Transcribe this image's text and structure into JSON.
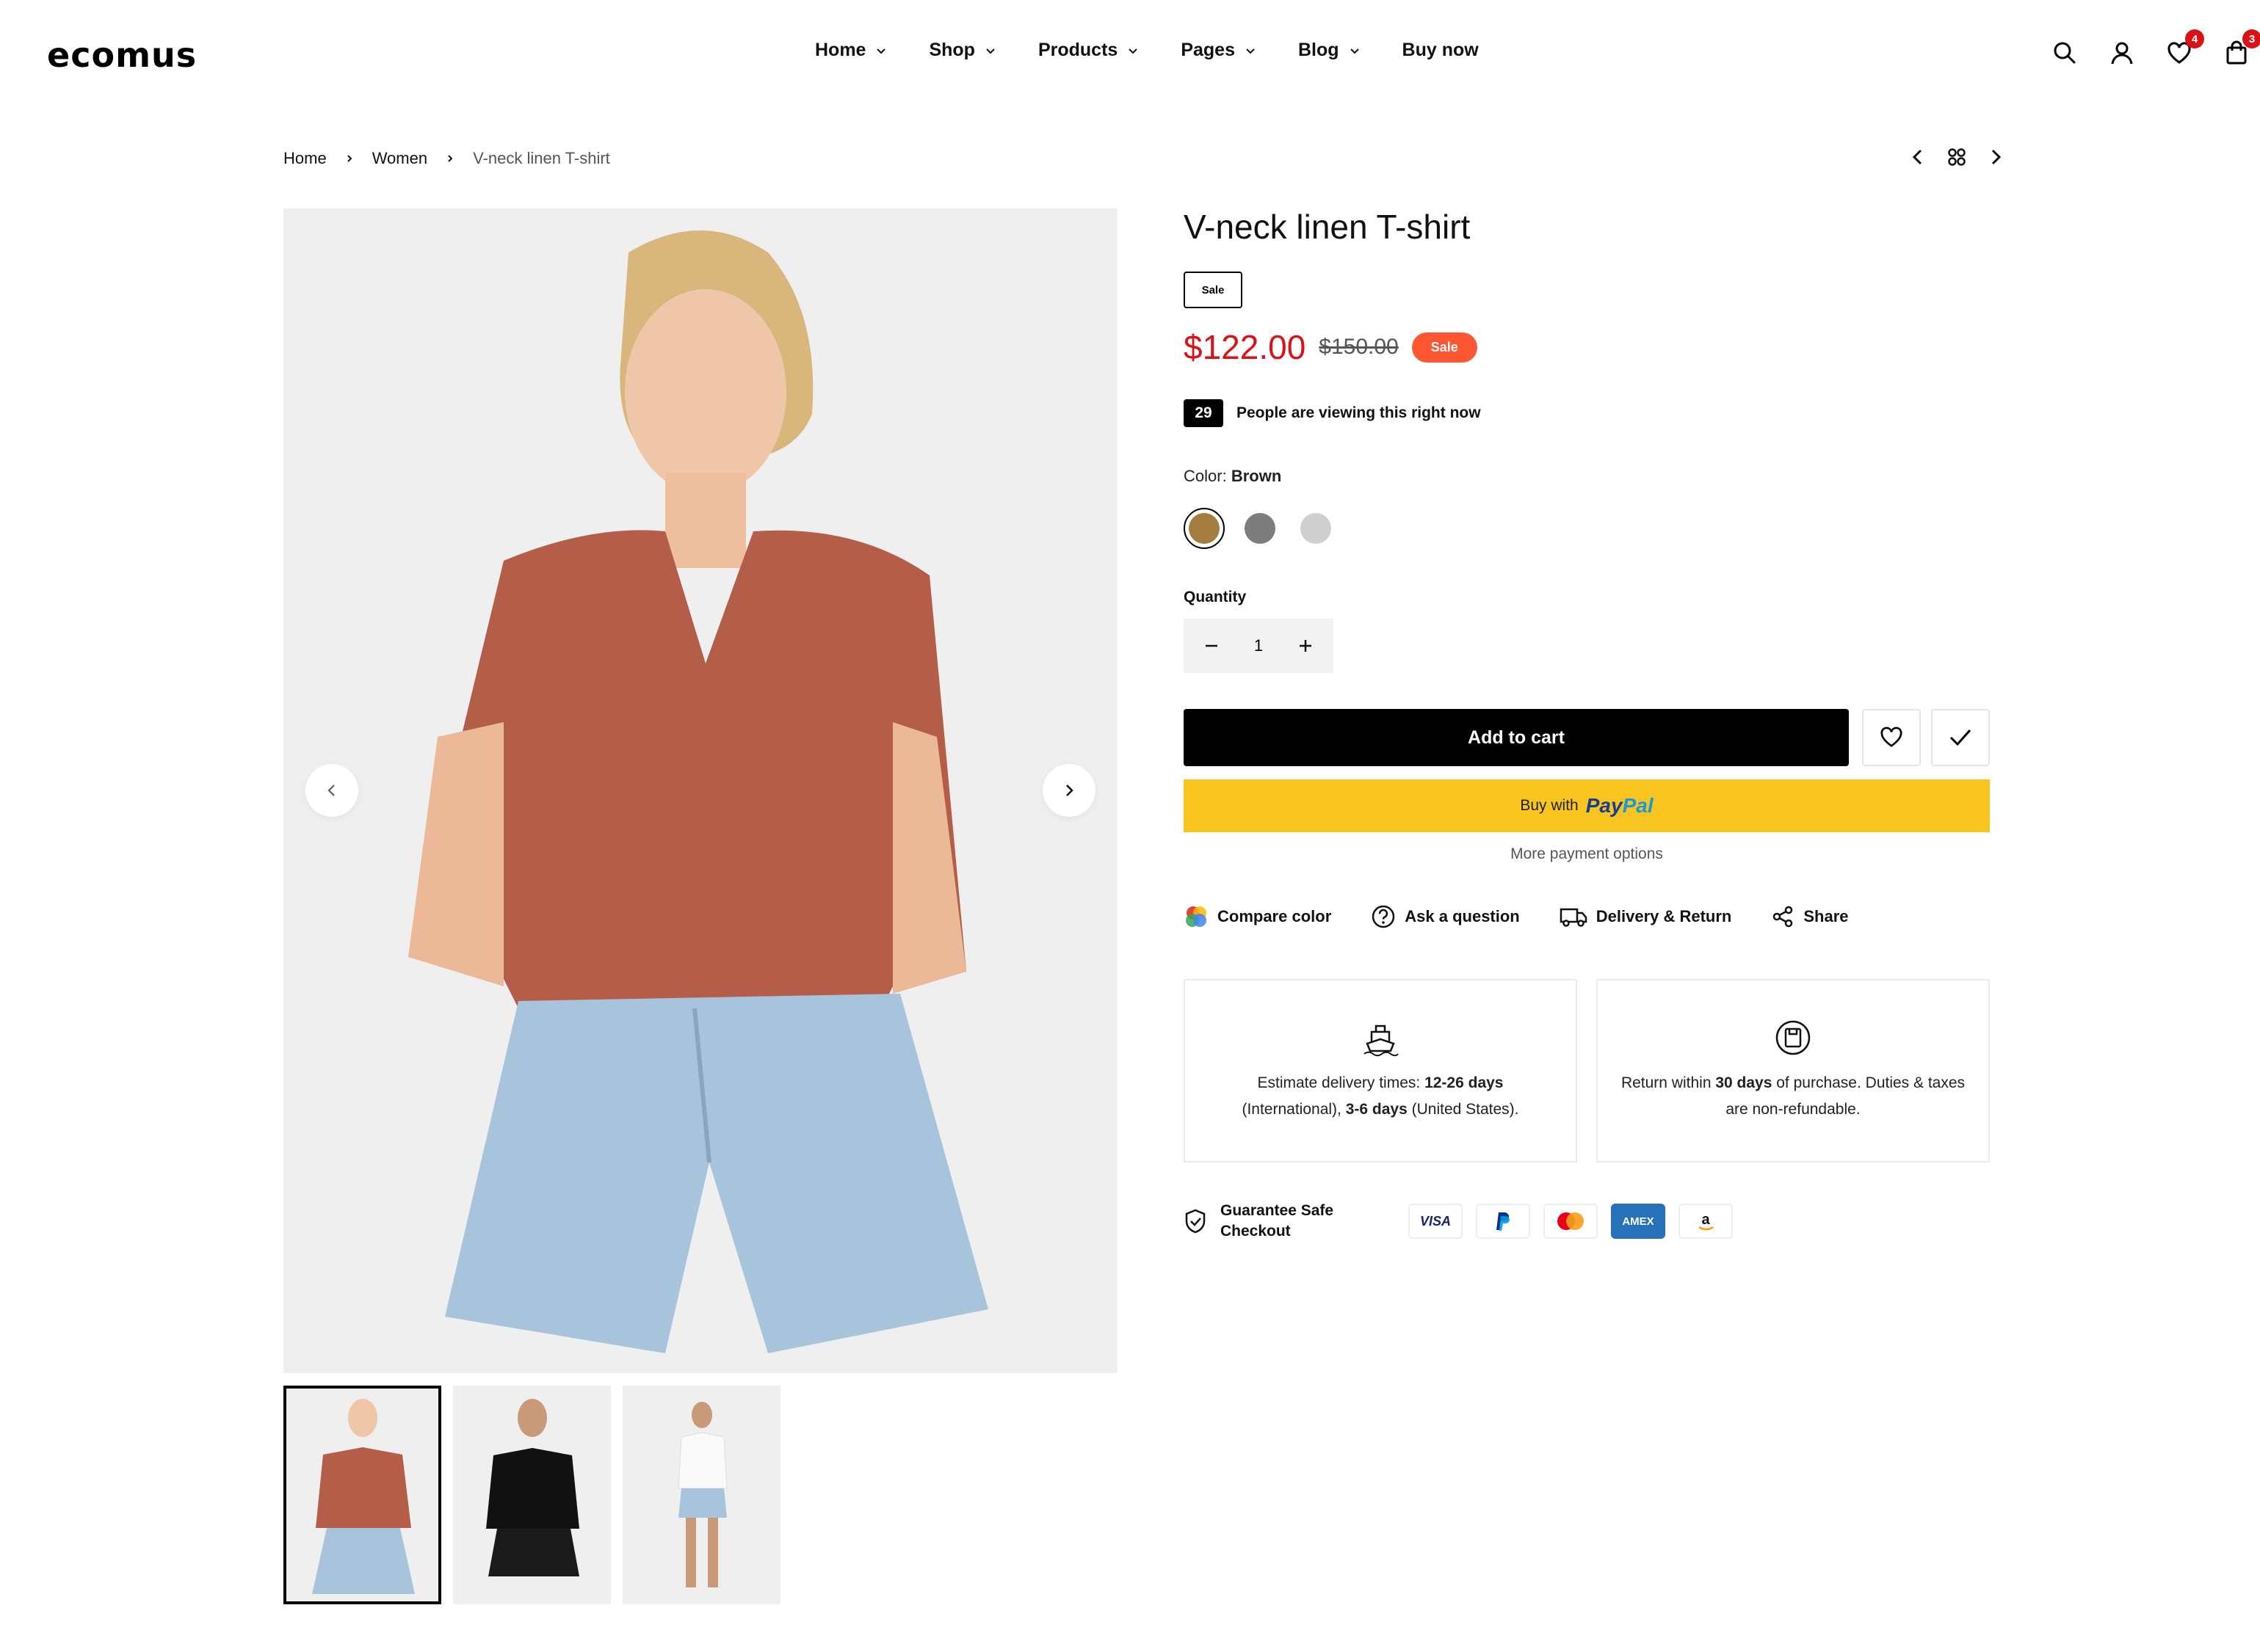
{
  "header": {
    "logo": "ecomus",
    "nav": [
      {
        "label": "Home",
        "has_dropdown": true
      },
      {
        "label": "Shop",
        "has_dropdown": true
      },
      {
        "label": "Products",
        "has_dropdown": true
      },
      {
        "label": "Pages",
        "has_dropdown": true
      },
      {
        "label": "Blog",
        "has_dropdown": true
      },
      {
        "label": "Buy now",
        "has_dropdown": false
      }
    ],
    "icons": [
      "search-icon",
      "user-icon",
      "heart-icon",
      "cart-icon"
    ],
    "wishlist_count": "4",
    "cart_count": "3",
    "badge_color": "#db1215"
  },
  "breadcrumb": {
    "items": [
      "Home",
      "Women",
      "V-neck linen T-shirt"
    ]
  },
  "gallery": {
    "thumb_count": 3,
    "active_thumb": 0
  },
  "product": {
    "title": "V-neck linen T-shirt",
    "tag": "Sale",
    "price": "$122.00",
    "compare_price": "$150.00",
    "sale_badge": "Sale",
    "viewing_count": "29",
    "viewing_text": "People are viewing this right now",
    "color_label": "Color:",
    "color_value": "Brown",
    "swatches": [
      {
        "name": "Brown",
        "hex": "#a57c3f",
        "selected": true
      },
      {
        "name": "Gray",
        "hex": "#7d7d7d",
        "selected": false
      },
      {
        "name": "Light Gray",
        "hex": "#cfcfcf",
        "selected": false
      }
    ],
    "quantity_label": "Quantity",
    "quantity": "1",
    "add_to_cart": "Add to cart",
    "paypal_prefix": "Buy with",
    "paypal_brand_a": "Pay",
    "paypal_brand_b": "Pal",
    "more_payment": "More payment options",
    "extras": [
      {
        "label": "Compare color",
        "icon": "compare-color-icon"
      },
      {
        "label": "Ask a question",
        "icon": "question-icon"
      },
      {
        "label": "Delivery & Return",
        "icon": "truck-icon"
      },
      {
        "label": "Share",
        "icon": "share-icon"
      }
    ],
    "delivery": {
      "t1": "Estimate delivery times: ",
      "b1": "12-26 days",
      "t2": " (International), ",
      "b2": "3-6 days",
      "t3": " (United States)."
    },
    "returns": {
      "t1": "Return within ",
      "b1": "30 days",
      "t2": " of purchase. Duties & taxes are non-refundable."
    },
    "guarantee": "Guarantee Safe Checkout",
    "payment_methods": [
      "VISA",
      "PayPal",
      "Mastercard",
      "AMEX",
      "Amazon"
    ],
    "price_color": "#db1215",
    "sale_color": "#fc5732",
    "paypal_color": "#f8c420"
  }
}
